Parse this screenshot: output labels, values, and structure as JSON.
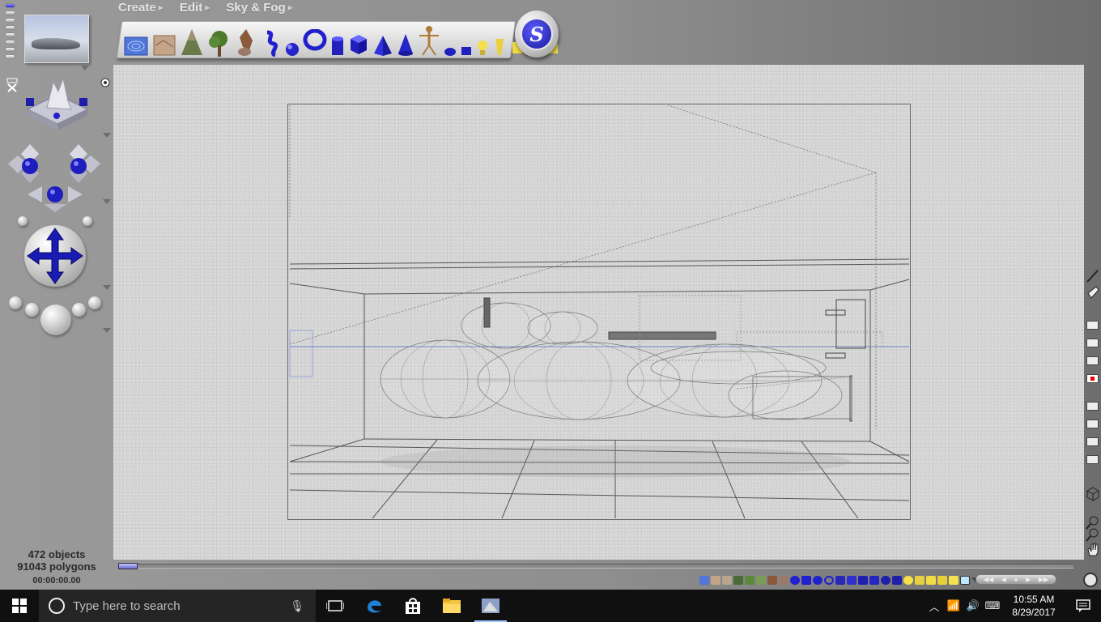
{
  "menu": {
    "create": "Create",
    "edit": "Edit",
    "sky_fog": "Sky & Fog"
  },
  "stats": {
    "objects": "472 objects",
    "polygons": "91043 polygons",
    "time": "00:00:00.00"
  },
  "library_icons": [
    "water-icon",
    "terrain-icon",
    "rock-icon",
    "mountain-icon",
    "tree-icon",
    "plant-icon",
    "boulder-icon",
    "metaball-icon",
    "torus-icon",
    "sphere-icon",
    "cylinder-icon",
    "cube-icon",
    "cone-icon",
    "pyramid-icon",
    "human-figure-icon",
    "disk-icon",
    "square-icon",
    "light-bulb-icon",
    "spotlight-icon",
    "quad-light-icon",
    "directional-light-icon",
    "cube-light-icon"
  ],
  "search": {
    "placeholder": "Type here to search"
  },
  "clock": {
    "time": "10:55 AM",
    "date": "8/29/2017"
  },
  "colors": {
    "accent_blue": "#2020cc",
    "viewport_bg": "#d4d4d4",
    "taskbar_bg": "#101010"
  }
}
